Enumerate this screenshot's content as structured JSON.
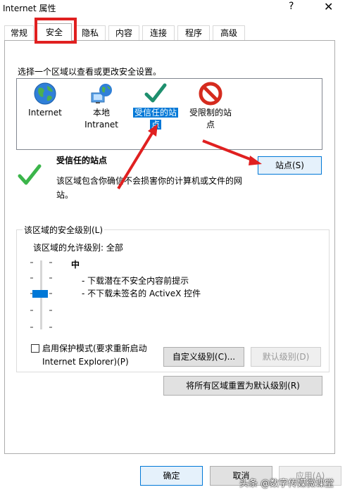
{
  "window": {
    "title": "Internet 属性",
    "help_glyph": "?",
    "close_glyph": "✕"
  },
  "tabs": [
    {
      "label": "常规"
    },
    {
      "label": "安全"
    },
    {
      "label": "隐私"
    },
    {
      "label": "内容"
    },
    {
      "label": "连接"
    },
    {
      "label": "程序"
    },
    {
      "label": "高级"
    }
  ],
  "active_tab": "安全",
  "security": {
    "instruction": "选择一个区域以查看或更改安全设置。",
    "zones": [
      {
        "label_line1": "Internet",
        "label_line2": "",
        "icon": "globe-icon"
      },
      {
        "label_line1": "本地",
        "label_line2": "Intranet",
        "icon": "local-intranet-icon"
      },
      {
        "label_line1": "受信任的站",
        "label_line2": "点",
        "icon": "green-check-icon",
        "selected": true
      },
      {
        "label_line1": "受限制的站",
        "label_line2": "点",
        "icon": "restricted-icon"
      }
    ],
    "selected_zone_title": "受信任的站点",
    "selected_zone_desc_line1": "该区域包含你确信不会损害你的计算机或文件的网",
    "selected_zone_desc_line2": "站。",
    "sites_button": "站点(S)",
    "group_legend": "该区域的安全级别(L)",
    "allowed_levels": "该区域的允许级别: 全部",
    "level_name": "中",
    "level_desc_1": "- 下载潜在不安全内容前提示",
    "level_desc_2": "- 不下载未签名的 ActiveX 控件",
    "protected_mode_line1": "启用保护模式(要求重新启动",
    "protected_mode_line2": "Internet Explorer)(P)",
    "protected_mode_checked": false,
    "custom_level_button": "自定义级别(C)...",
    "default_level_button": "默认级别(D)",
    "reset_all_button": "将所有区域重置为默认级别(R)"
  },
  "footer": {
    "ok": "确定",
    "cancel": "取消",
    "apply": "应用(A)"
  },
  "watermark": "头条 @数字传媒微课堂",
  "colors": {
    "accent": "#0078d7",
    "annotation_red": "#e02020"
  }
}
